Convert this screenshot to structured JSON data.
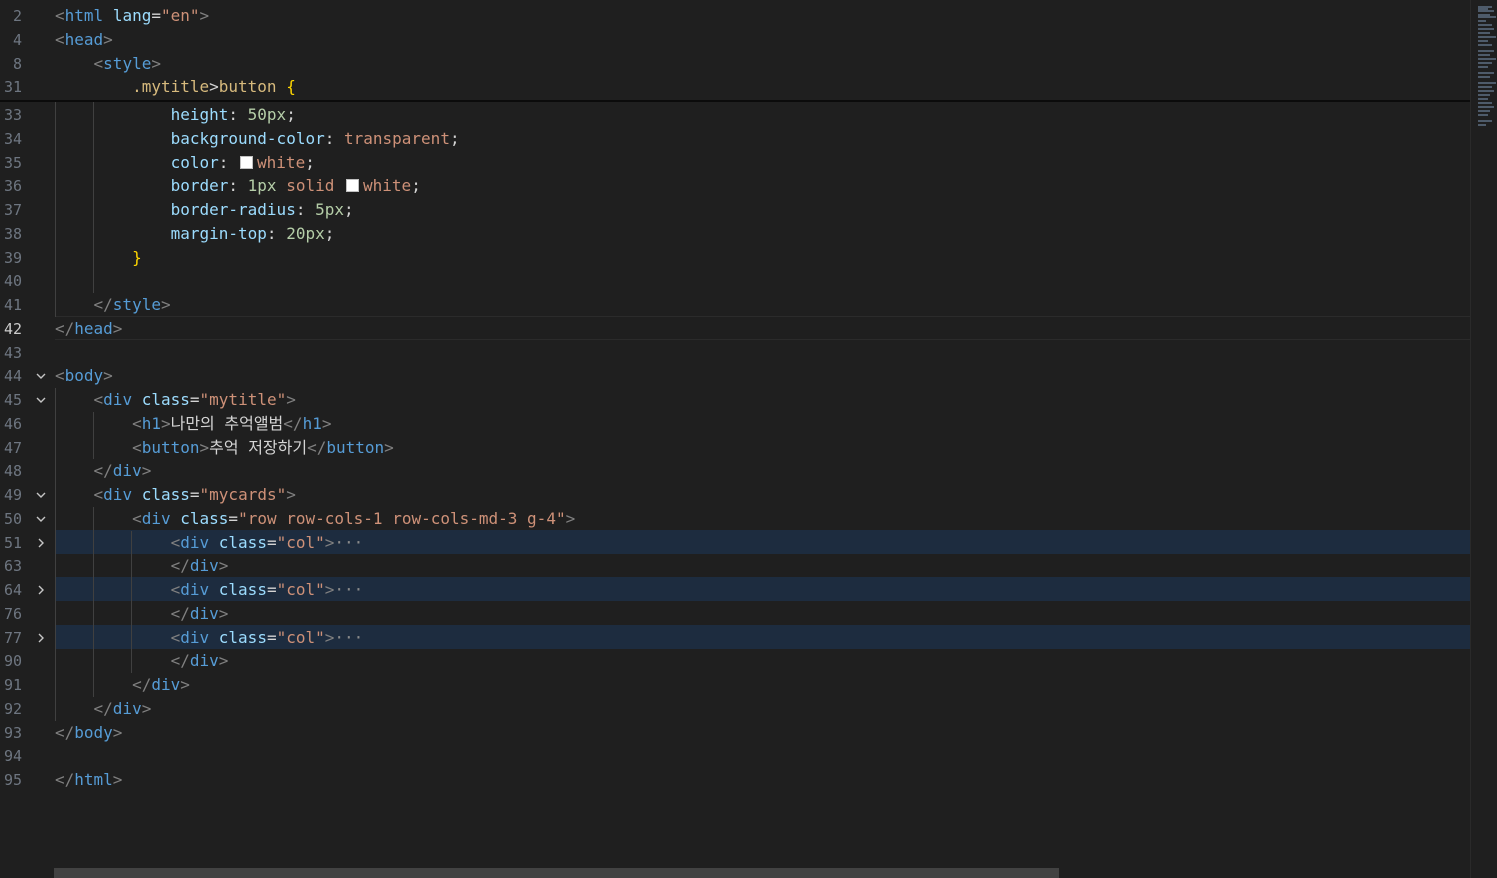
{
  "editor": {
    "lines": [
      {
        "num": "2",
        "tokens": [
          [
            "t-punc",
            "<"
          ],
          [
            "t-tag",
            "html"
          ],
          [
            "t-text",
            " "
          ],
          [
            "t-attr",
            "lang"
          ],
          [
            "t-text",
            "="
          ],
          [
            "t-str",
            "\"en\""
          ],
          [
            "t-punc",
            ">"
          ]
        ]
      },
      {
        "num": "4",
        "tokens": [
          [
            "t-punc",
            "<"
          ],
          [
            "t-tag",
            "head"
          ],
          [
            "t-punc",
            ">"
          ]
        ]
      },
      {
        "num": "8",
        "tokens": [
          [
            "t-text",
            "    "
          ],
          [
            "t-punc",
            "<"
          ],
          [
            "t-tag",
            "style"
          ],
          [
            "t-punc",
            ">"
          ]
        ]
      },
      {
        "num": "31",
        "tokens": [
          [
            "t-text",
            "        "
          ],
          [
            "t-sel",
            ".mytitle"
          ],
          [
            "t-text",
            ">"
          ],
          [
            "t-sel",
            "button"
          ],
          [
            "t-text",
            " "
          ],
          [
            "t-brace",
            "{"
          ]
        ]
      },
      {
        "num": "33",
        "tokens": [
          [
            "t-text",
            "            "
          ],
          [
            "t-prop",
            "height"
          ],
          [
            "t-text",
            ": "
          ],
          [
            "t-num",
            "50px"
          ],
          [
            "t-text",
            ";"
          ]
        ]
      },
      {
        "num": "34",
        "tokens": [
          [
            "t-text",
            "            "
          ],
          [
            "t-prop",
            "background-color"
          ],
          [
            "t-text",
            ": "
          ],
          [
            "t-val",
            "transparent"
          ],
          [
            "t-text",
            ";"
          ]
        ]
      },
      {
        "num": "35",
        "tokens": [
          [
            "t-text",
            "            "
          ],
          [
            "t-prop",
            "color"
          ],
          [
            "t-text",
            ": "
          ],
          [
            "swatch",
            ""
          ],
          [
            "t-val",
            "white"
          ],
          [
            "t-text",
            ";"
          ]
        ]
      },
      {
        "num": "36",
        "tokens": [
          [
            "t-text",
            "            "
          ],
          [
            "t-prop",
            "border"
          ],
          [
            "t-text",
            ": "
          ],
          [
            "t-num",
            "1px"
          ],
          [
            "t-text",
            " "
          ],
          [
            "t-val",
            "solid"
          ],
          [
            "t-text",
            " "
          ],
          [
            "swatch",
            ""
          ],
          [
            "t-val",
            "white"
          ],
          [
            "t-text",
            ";"
          ]
        ]
      },
      {
        "num": "37",
        "tokens": [
          [
            "t-text",
            "            "
          ],
          [
            "t-prop",
            "border-radius"
          ],
          [
            "t-text",
            ": "
          ],
          [
            "t-num",
            "5px"
          ],
          [
            "t-text",
            ";"
          ]
        ]
      },
      {
        "num": "38",
        "tokens": [
          [
            "t-text",
            "            "
          ],
          [
            "t-prop",
            "margin-top"
          ],
          [
            "t-text",
            ": "
          ],
          [
            "t-num",
            "20px"
          ],
          [
            "t-text",
            ";"
          ]
        ]
      },
      {
        "num": "39",
        "tokens": [
          [
            "t-text",
            "        "
          ],
          [
            "t-brace",
            "}"
          ]
        ]
      },
      {
        "num": "40",
        "tokens": []
      },
      {
        "num": "41",
        "tokens": [
          [
            "t-text",
            "    "
          ],
          [
            "t-punc",
            "</"
          ],
          [
            "t-tag",
            "style"
          ],
          [
            "t-punc",
            ">"
          ]
        ]
      },
      {
        "num": "42",
        "tokens": [
          [
            "t-punc",
            "</"
          ],
          [
            "t-tag",
            "head"
          ],
          [
            "t-punc",
            ">"
          ]
        ]
      },
      {
        "num": "43",
        "tokens": []
      },
      {
        "num": "44",
        "tokens": [
          [
            "t-punc",
            "<"
          ],
          [
            "t-tag",
            "body"
          ],
          [
            "t-punc",
            ">"
          ]
        ]
      },
      {
        "num": "45",
        "tokens": [
          [
            "t-text",
            "    "
          ],
          [
            "t-punc",
            "<"
          ],
          [
            "t-tag",
            "div"
          ],
          [
            "t-text",
            " "
          ],
          [
            "t-attr",
            "class"
          ],
          [
            "t-text",
            "="
          ],
          [
            "t-str",
            "\"mytitle\""
          ],
          [
            "t-punc",
            ">"
          ]
        ]
      },
      {
        "num": "46",
        "tokens": [
          [
            "t-text",
            "        "
          ],
          [
            "t-punc",
            "<"
          ],
          [
            "t-tag",
            "h1"
          ],
          [
            "t-punc",
            ">"
          ],
          [
            "t-text",
            "나만의 추억앨범"
          ],
          [
            "t-punc",
            "</"
          ],
          [
            "t-tag",
            "h1"
          ],
          [
            "t-punc",
            ">"
          ]
        ]
      },
      {
        "num": "47",
        "tokens": [
          [
            "t-text",
            "        "
          ],
          [
            "t-punc",
            "<"
          ],
          [
            "t-tag",
            "button"
          ],
          [
            "t-punc",
            ">"
          ],
          [
            "t-text",
            "추억 저장하기"
          ],
          [
            "t-punc",
            "</"
          ],
          [
            "t-tag",
            "button"
          ],
          [
            "t-punc",
            ">"
          ]
        ]
      },
      {
        "num": "48",
        "tokens": [
          [
            "t-text",
            "    "
          ],
          [
            "t-punc",
            "</"
          ],
          [
            "t-tag",
            "div"
          ],
          [
            "t-punc",
            ">"
          ]
        ]
      },
      {
        "num": "49",
        "tokens": [
          [
            "t-text",
            "    "
          ],
          [
            "t-punc",
            "<"
          ],
          [
            "t-tag",
            "div"
          ],
          [
            "t-text",
            " "
          ],
          [
            "t-attr",
            "class"
          ],
          [
            "t-text",
            "="
          ],
          [
            "t-str",
            "\"mycards\""
          ],
          [
            "t-punc",
            ">"
          ]
        ]
      },
      {
        "num": "50",
        "tokens": [
          [
            "t-text",
            "        "
          ],
          [
            "t-punc",
            "<"
          ],
          [
            "t-tag",
            "div"
          ],
          [
            "t-text",
            " "
          ],
          [
            "t-attr",
            "class"
          ],
          [
            "t-text",
            "="
          ],
          [
            "t-str",
            "\"row row-cols-1 row-cols-md-3 g-4\""
          ],
          [
            "t-punc",
            ">"
          ]
        ]
      },
      {
        "num": "51",
        "tokens": [
          [
            "t-text",
            "            "
          ],
          [
            "t-punc",
            "<"
          ],
          [
            "t-tag",
            "div"
          ],
          [
            "t-text",
            " "
          ],
          [
            "t-attr",
            "class"
          ],
          [
            "t-text",
            "="
          ],
          [
            "t-str",
            "\"col\""
          ],
          [
            "t-punc",
            ">"
          ],
          [
            "t-ellipsis",
            "···"
          ]
        ]
      },
      {
        "num": "63",
        "tokens": [
          [
            "t-text",
            "            "
          ],
          [
            "t-punc",
            "</"
          ],
          [
            "t-tag",
            "div"
          ],
          [
            "t-punc",
            ">"
          ]
        ]
      },
      {
        "num": "64",
        "tokens": [
          [
            "t-text",
            "            "
          ],
          [
            "t-punc",
            "<"
          ],
          [
            "t-tag",
            "div"
          ],
          [
            "t-text",
            " "
          ],
          [
            "t-attr",
            "class"
          ],
          [
            "t-text",
            "="
          ],
          [
            "t-str",
            "\"col\""
          ],
          [
            "t-punc",
            ">"
          ],
          [
            "t-ellipsis",
            "···"
          ]
        ]
      },
      {
        "num": "76",
        "tokens": [
          [
            "t-text",
            "            "
          ],
          [
            "t-punc",
            "</"
          ],
          [
            "t-tag",
            "div"
          ],
          [
            "t-punc",
            ">"
          ]
        ]
      },
      {
        "num": "77",
        "tokens": [
          [
            "t-text",
            "            "
          ],
          [
            "t-punc",
            "<"
          ],
          [
            "t-tag",
            "div"
          ],
          [
            "t-text",
            " "
          ],
          [
            "t-attr",
            "class"
          ],
          [
            "t-text",
            "="
          ],
          [
            "t-str",
            "\"col\""
          ],
          [
            "t-punc",
            ">"
          ],
          [
            "t-ellipsis",
            "···"
          ]
        ]
      },
      {
        "num": "90",
        "tokens": [
          [
            "t-text",
            "            "
          ],
          [
            "t-punc",
            "</"
          ],
          [
            "t-tag",
            "div"
          ],
          [
            "t-punc",
            ">"
          ]
        ]
      },
      {
        "num": "91",
        "tokens": [
          [
            "t-text",
            "        "
          ],
          [
            "t-punc",
            "</"
          ],
          [
            "t-tag",
            "div"
          ],
          [
            "t-punc",
            ">"
          ]
        ]
      },
      {
        "num": "92",
        "tokens": [
          [
            "t-text",
            "    "
          ],
          [
            "t-punc",
            "</"
          ],
          [
            "t-tag",
            "div"
          ],
          [
            "t-punc",
            ">"
          ]
        ]
      },
      {
        "num": "93",
        "tokens": [
          [
            "t-punc",
            "</"
          ],
          [
            "t-tag",
            "body"
          ],
          [
            "t-punc",
            ">"
          ]
        ]
      },
      {
        "num": "94",
        "tokens": []
      },
      {
        "num": "95",
        "tokens": [
          [
            "t-punc",
            "</"
          ],
          [
            "t-tag",
            "html"
          ],
          [
            "t-punc",
            ">"
          ]
        ]
      }
    ],
    "current_line": "42",
    "folded_lines": [
      "51",
      "64",
      "77"
    ],
    "expanded_fold_lines": [
      "44",
      "45",
      "49",
      "50"
    ],
    "colors": {
      "background": "#1f1f1f",
      "highlight_row": "#1d2c3f",
      "line_number": "#6e7681",
      "tag": "#569cd6",
      "attribute": "#9cdcfe",
      "string": "#ce9178",
      "selector": "#d7ba7d",
      "bracket": "#ffd700",
      "number": "#b5cea8"
    },
    "icons": {
      "expanded": "chevron-down-icon",
      "collapsed": "chevron-right-icon",
      "color_swatch": "color-swatch-icon"
    }
  }
}
